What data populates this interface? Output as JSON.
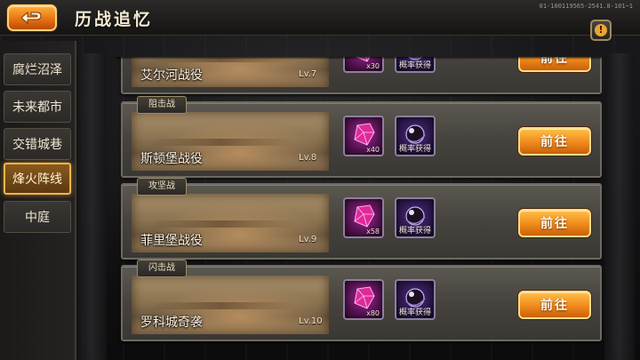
{
  "header": {
    "title": "历战追忆",
    "version": "01-100119565-2541.8-101~1",
    "back_icon": "back-arrow-icon",
    "info_icon": "exclamation-icon"
  },
  "sidebar": {
    "items": [
      {
        "label": "腐烂沼泽",
        "active": false
      },
      {
        "label": "未来都市",
        "active": false
      },
      {
        "label": "交错城巷",
        "active": false
      },
      {
        "label": "烽火阵线",
        "active": true
      },
      {
        "label": "中庭",
        "active": false
      }
    ]
  },
  "battles": [
    {
      "tag": "",
      "name": "艾尔河战役",
      "level": "Lv.7",
      "gem_count": "x30",
      "drop_label": "概率获得",
      "button": "前往"
    },
    {
      "tag": "阻击战",
      "name": "斯顿堡战役",
      "level": "Lv.8",
      "gem_count": "x40",
      "drop_label": "概率获得",
      "button": "前往"
    },
    {
      "tag": "攻坚战",
      "name": "菲里堡战役",
      "level": "Lv.9",
      "gem_count": "x58",
      "drop_label": "概率获得",
      "button": "前往"
    },
    {
      "tag": "闪击战",
      "name": "罗科城奇袭",
      "level": "Lv.10",
      "gem_count": "x80",
      "drop_label": "概率获得",
      "button": "前往"
    }
  ],
  "colors": {
    "accent_orange": "#f08a1b",
    "active_border": "#f0b64a",
    "gem_purple": "#a0279a"
  }
}
